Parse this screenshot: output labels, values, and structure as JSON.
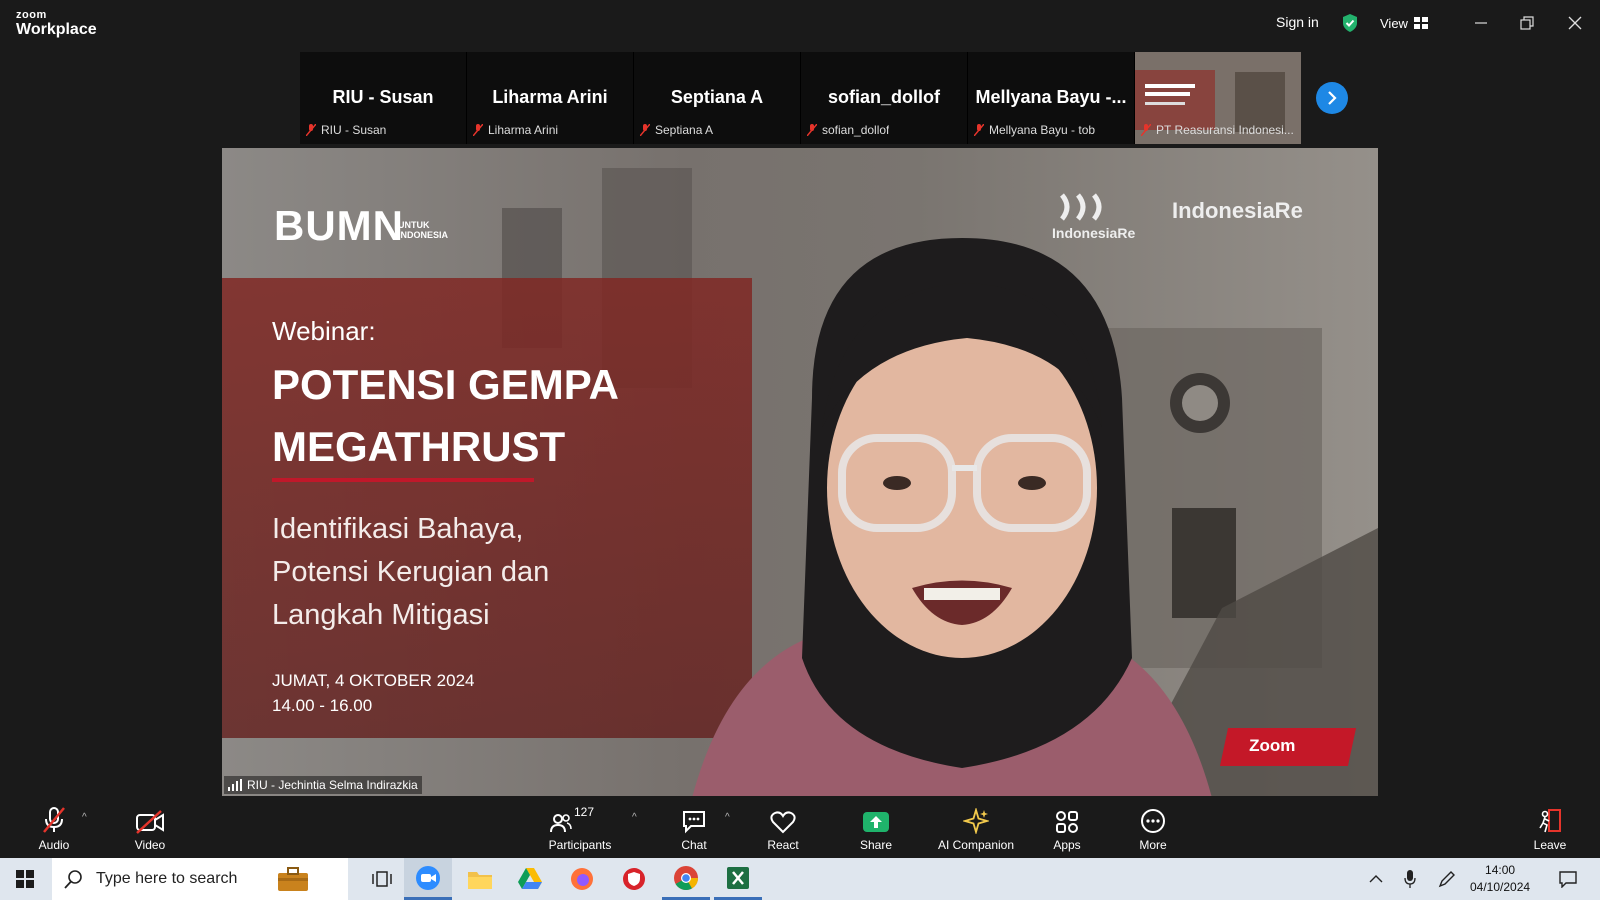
{
  "app": {
    "brand_small": "zoom",
    "brand_large": "Workplace"
  },
  "titlebar": {
    "signin": "Sign in",
    "view": "View"
  },
  "thumbnails": [
    {
      "big": "RIU - Susan",
      "small": "RIU - Susan"
    },
    {
      "big": "Liharma Arini",
      "small": "Liharma Arini"
    },
    {
      "big": "Septiana A",
      "small": "Septiana A"
    },
    {
      "big": "sofian_dollof",
      "small": "sofian_dollof"
    },
    {
      "big": "Mellyana Bayu -...",
      "small": "Mellyana Bayu - tob"
    },
    {
      "big": "",
      "small": "PT Reasuransi Indonesi..."
    }
  ],
  "slide": {
    "logo": "BUMN",
    "logo_sub1": "UNTUK",
    "logo_sub2": "INDONESIA",
    "logo_right1": "IndonesiaRe",
    "logo_right2": "IndonesiaRe",
    "webinar": "Webinar:",
    "title1": "POTENSI GEMPA",
    "title2": "MEGATHRUST",
    "sub1": "Identifikasi Bahaya,",
    "sub2": "Potensi Kerugian dan",
    "sub3": "Langkah Mitigasi",
    "date": "JUMAT, 4 OKTOBER 2024",
    "time": "14.00 - 16.00",
    "zoom_tag": "Zoom"
  },
  "speaker": {
    "name": "RIU - Jechintia Selma Indirazkia"
  },
  "toolbar": {
    "audio": "Audio",
    "video": "Video",
    "participants": "Participants",
    "participant_count": "127",
    "chat": "Chat",
    "react": "React",
    "share": "Share",
    "ai_companion": "AI Companion",
    "apps": "Apps",
    "more": "More",
    "leave": "Leave"
  },
  "taskbar": {
    "search_placeholder": "Type here to search",
    "time": "14:00",
    "date": "04/10/2024"
  },
  "colors": {
    "accent_blue": "#1e88e5",
    "share_green": "#1fb36b",
    "leave_red": "#e5342b",
    "mute_red": "#e5342b"
  }
}
